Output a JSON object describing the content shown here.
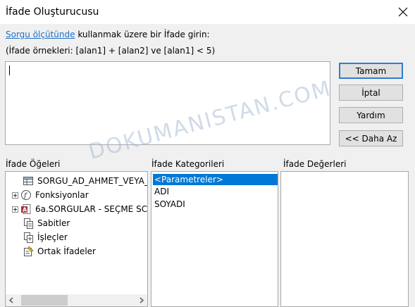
{
  "window": {
    "title": "İfade Oluşturucusu"
  },
  "instructions": {
    "link": "Sorgu ölçütünde",
    "line1_rest": " kullanmak üzere bir İfade girin:",
    "line2": "(İfade örnekleri: [alan1] + [alan2] ve [alan1] < 5)"
  },
  "expression": {
    "value": ""
  },
  "buttons": {
    "ok": "Tamam",
    "cancel": "İptal",
    "help": "Yardım",
    "less": "<< Daha Az"
  },
  "panels": {
    "elements_label": "İfade Öğeleri",
    "categories_label": "İfade Kategorileri",
    "values_label": "İfade Değerleri"
  },
  "elements_tree": [
    {
      "label": "SORGU_AD_AHMET_VEYA_",
      "icon": "query-icon",
      "expandable": false
    },
    {
      "label": "Fonksiyonlar",
      "icon": "function-icon",
      "expandable": true
    },
    {
      "label": "6a.SORGULAR - SEÇME SC",
      "icon": "access-db-icon",
      "expandable": true
    },
    {
      "label": "Sabitler",
      "icon": "constants-icon",
      "expandable": false
    },
    {
      "label": "İşleçler",
      "icon": "operators-icon",
      "expandable": false
    },
    {
      "label": "Ortak İfadeler",
      "icon": "common-expressions-icon",
      "expandable": false
    }
  ],
  "categories": [
    {
      "label": "<Parametreler>",
      "selected": true
    },
    {
      "label": "ADI",
      "selected": false
    },
    {
      "label": "SOYADI",
      "selected": false
    }
  ],
  "watermark": "DOKUMANISTAN.COM"
}
